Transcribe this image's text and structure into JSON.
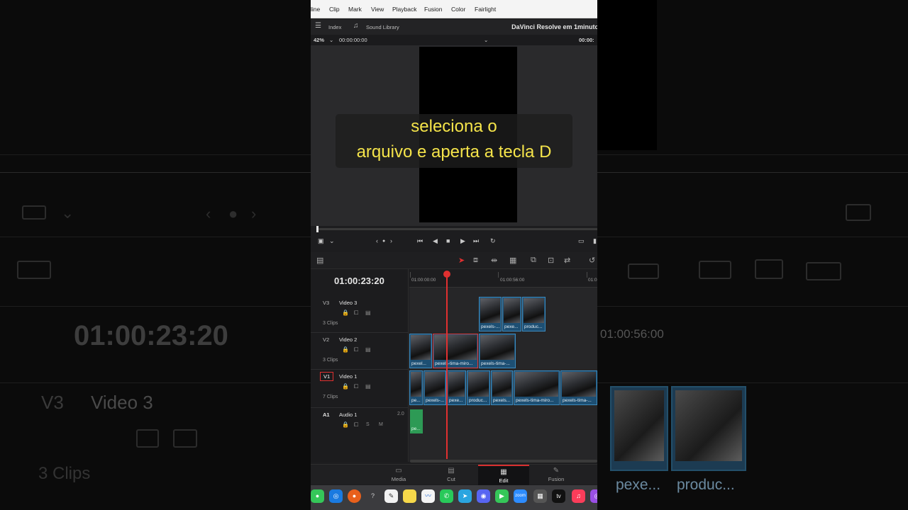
{
  "menu": [
    "line",
    "Clip",
    "Mark",
    "View",
    "Playback",
    "Fusion",
    "Color",
    "Fairlight"
  ],
  "toolbar": {
    "index": "Index",
    "sound_library": "Sound Library",
    "project_title": "DaVinci Resolve em 1minuto"
  },
  "viewer_bar": {
    "zoom": "42%",
    "source_tc": "00:00:00:00",
    "record_tc": "00:00:"
  },
  "caption": {
    "line1": "seleciona o",
    "line2": "arquivo e aperta a tecla D"
  },
  "timecode": "01:00:23:20",
  "ruler": [
    "01:00:00:00",
    "01:00:56:00",
    "01:0"
  ],
  "tracks": [
    {
      "id": "V3",
      "name": "Video 3",
      "clips": "3 Clips"
    },
    {
      "id": "V2",
      "name": "Video 2",
      "clips": "3 Clips"
    },
    {
      "id": "V1",
      "name": "Video 1",
      "clips": "7 Clips"
    },
    {
      "id": "A1",
      "name": "Audio 1",
      "channels": "2.0",
      "solo": "S",
      "mute": "M"
    }
  ],
  "clips": {
    "v3": [
      "pexels-...",
      "pexe...",
      "produc..."
    ],
    "v2": [
      "pexel...",
      "pexels-tima-miro...",
      "pexels-tima-..."
    ],
    "v1": [
      "pe...",
      "pexels-...",
      "pexe...",
      "produc...",
      "pexels...",
      "pexels-tima-miro...",
      "pexels-tima-..."
    ],
    "a1": [
      "pe..."
    ]
  },
  "pages": [
    "Media",
    "Cut",
    "Edit",
    "Fusion"
  ],
  "active_page": "Edit",
  "dock": [
    "Messages",
    "Safari",
    "Firefox",
    "Help",
    "TextEdit",
    "Notes",
    "Freeform",
    "WhatsApp",
    "Telegram",
    "Discord",
    "FaceTime",
    "zoom",
    "Calculator",
    "tv",
    "Music",
    "Podcasts"
  ],
  "background": {
    "timecode": "01:00:23:20",
    "track_id": "V3",
    "track_name": "Video 3",
    "clips": "3 Clips",
    "ruler_tc": "01:00:56:00",
    "clip_a": "pexe...",
    "clip_b": "produc..."
  },
  "colors": {
    "accent": "#e03030",
    "caption": "#f5e44a",
    "video_clip": "#1d4f73",
    "audio_clip": "#2d9a55"
  }
}
